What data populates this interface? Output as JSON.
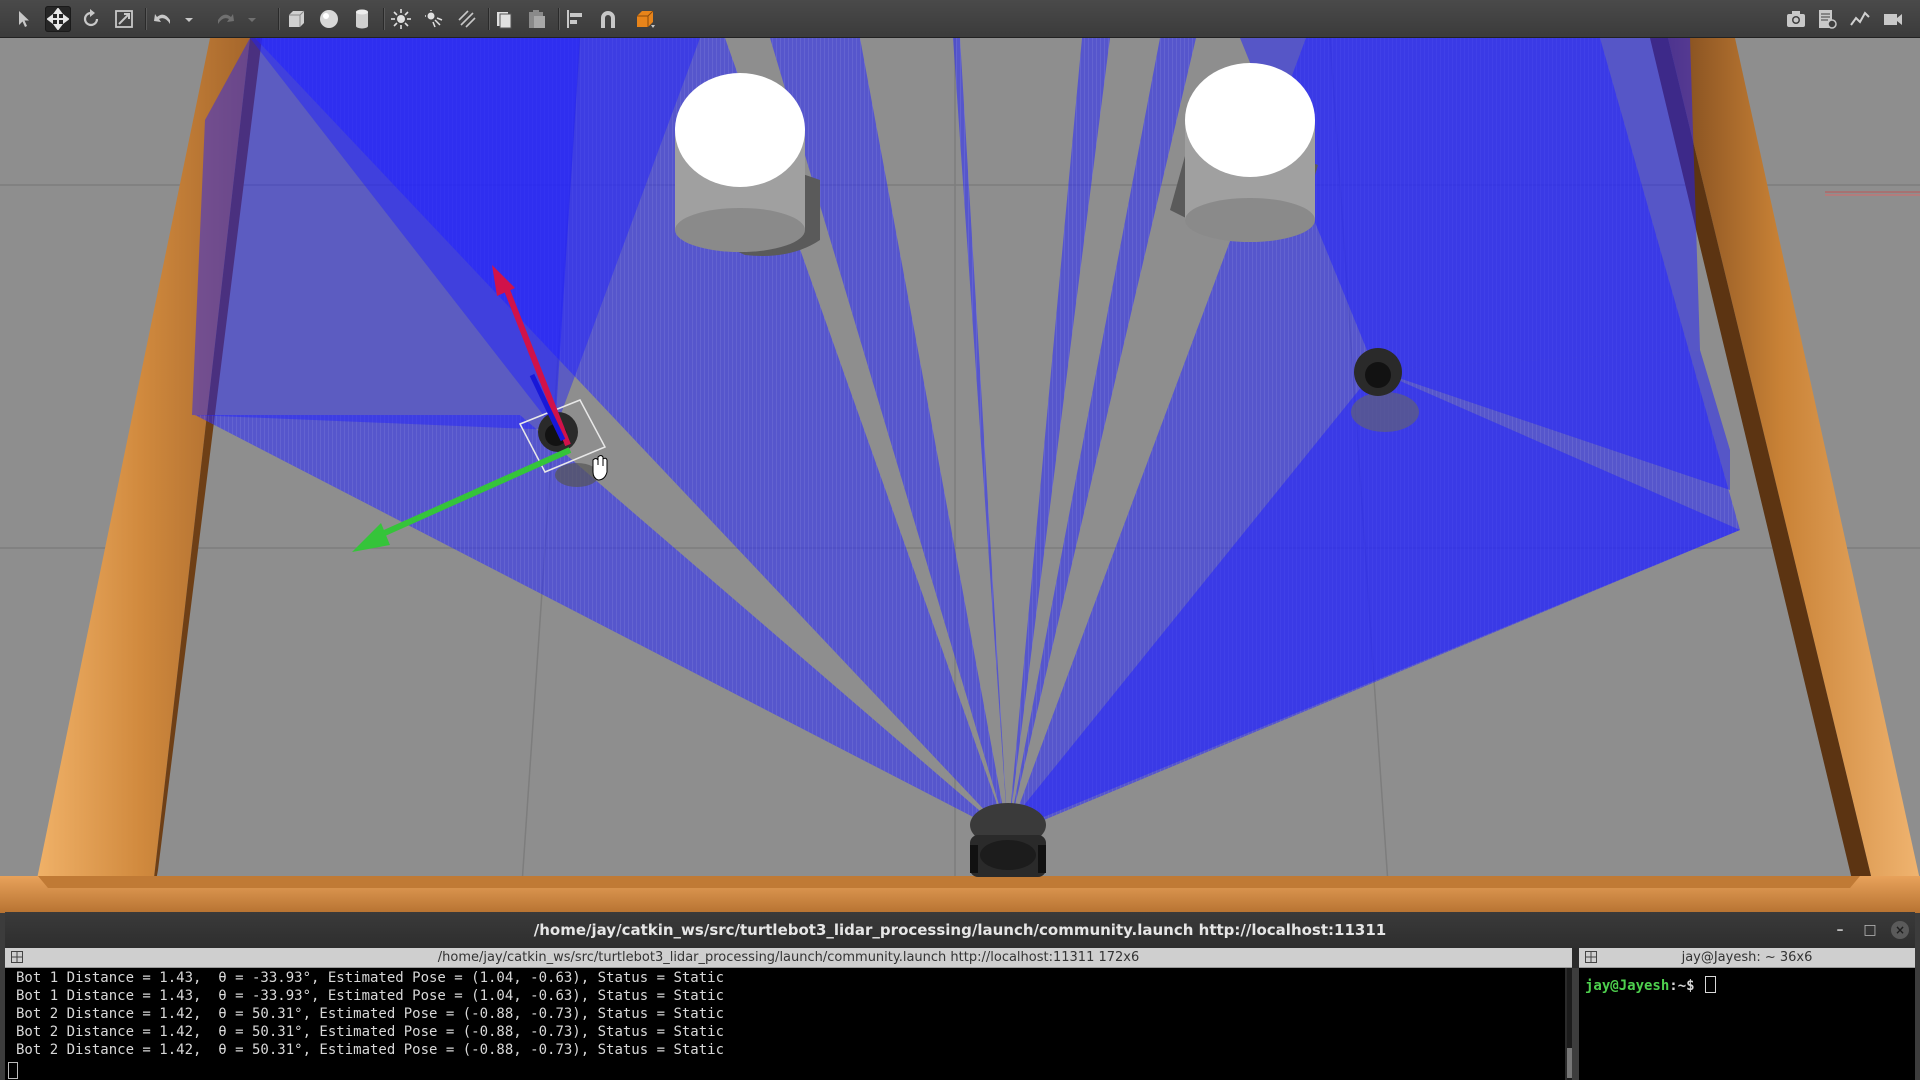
{
  "toolbar": {
    "items": [
      {
        "name": "select-mode-icon",
        "active": false
      },
      {
        "name": "translate-mode-icon",
        "active": true
      },
      {
        "name": "rotate-mode-icon",
        "active": false
      },
      {
        "name": "scale-mode-icon",
        "active": false
      },
      {
        "name": "undo-icon",
        "active": false
      },
      {
        "name": "redo-icon",
        "active": false
      },
      {
        "name": "box-shape-icon",
        "active": false
      },
      {
        "name": "sphere-shape-icon",
        "active": false
      },
      {
        "name": "cylinder-shape-icon",
        "active": false
      },
      {
        "name": "point-light-icon",
        "active": false
      },
      {
        "name": "spot-light-icon",
        "active": false
      },
      {
        "name": "directional-light-icon",
        "active": false
      },
      {
        "name": "copy-icon",
        "active": false
      },
      {
        "name": "paste-icon",
        "active": false
      },
      {
        "name": "align-icon",
        "active": false
      },
      {
        "name": "snap-icon",
        "active": false
      },
      {
        "name": "change-view-icon",
        "active": false
      },
      {
        "name": "screenshot-icon",
        "active": false
      },
      {
        "name": "log-icon",
        "active": false
      },
      {
        "name": "plot-icon",
        "active": false
      },
      {
        "name": "record-video-icon",
        "active": false
      }
    ],
    "colors": {
      "bar": "#3f3f3f",
      "icon": "#c8c8c8",
      "accent": "#e8841a"
    }
  },
  "viewport": {
    "colors": {
      "ground": "#8e8e8e",
      "wall": "#c9813c",
      "lidar": "#1a1aff",
      "x_axis": "#d1124a",
      "y_axis": "#35c43a"
    }
  },
  "terminal": {
    "window_title": "/home/jay/catkin_ws/src/turtlebot3_lidar_processing/launch/community.launch http://localhost:11311",
    "left_pane_title": "/home/jay/catkin_ws/src/turtlebot3_lidar_processing/launch/community.launch http://localhost:11311 172x6",
    "right_pane_title": "jay@Jayesh: ~ 36x6",
    "lines": [
      "Bot 1 Distance = 1.43,  θ = -33.93°, Estimated Pose = (1.04, -0.63), Status = Static",
      "Bot 1 Distance = 1.43,  θ = -33.93°, Estimated Pose = (1.04, -0.63), Status = Static",
      "Bot 2 Distance = 1.42,  θ = 50.31°, Estimated Pose = (-0.88, -0.73), Status = Static",
      "Bot 2 Distance = 1.42,  θ = 50.31°, Estimated Pose = (-0.88, -0.73), Status = Static",
      "Bot 2 Distance = 1.42,  θ = 50.31°, Estimated Pose = (-0.88, -0.73), Status = Static"
    ],
    "prompt_user": "jay@Jayesh",
    "prompt_path": ":~$",
    "buttons": {
      "minimize": "–",
      "maximize": "□",
      "close": "×"
    }
  }
}
